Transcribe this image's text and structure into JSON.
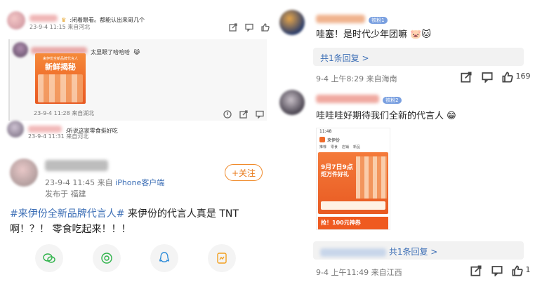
{
  "panel1": {
    "comment1": {
      "text": ":闭着眼看。都能认出来哥几个",
      "meta": "23-9-4 11:15 来自河北"
    },
    "nested_comment": {
      "text": "太显眼了哈哈哈",
      "poster_title": "新鲜揭秘",
      "poster_subtitle": "来伊份全新品牌代言人",
      "meta": "23-9-4 11:28 来自湖北"
    },
    "comment2": {
      "text": ":听说这家零食挺好吃",
      "meta": "23-9-4 11:31 来自河北"
    }
  },
  "panel2": {
    "meta_date": "23-9-4 11:45 来自",
    "meta_client": "iPhone客户端",
    "location": "发布于 福建",
    "follow_label": "+关注",
    "hashtag": "#来伊份全新品牌代言人#",
    "text_line1": " 来伊份的代言人真是 TNT",
    "text_line2": "啊！？！ 零食吃起来！！！"
  },
  "panel3": {
    "comment1": {
      "fan_badge": "铁粉1",
      "text": "哇塞！是时代少年团嘛",
      "reply_count": "共1条回复 >",
      "meta": "9-4 上午8:29 来自海南",
      "likes": "169"
    },
    "comment2": {
      "fan_badge": "铁粉2",
      "text": "哇哇哇好期待我们全新的代言人",
      "phone_time": "11:48",
      "store_name": "来伊份",
      "tabs": [
        "推荐",
        "零食",
        "店铺",
        "新品"
      ],
      "promo_line1": "9月7日9点",
      "promo_line2": "炬万件好礼",
      "promo_bottom": "抢！100元神券",
      "reply_count": "共1条回复 >",
      "meta": "9-4 上午11:49 来自江西",
      "likes": "1"
    }
  },
  "colors": {
    "link_blue": "#3d6fb6",
    "accent_orange": "#f08a2a",
    "poster_orange": "#ef6a2a"
  }
}
